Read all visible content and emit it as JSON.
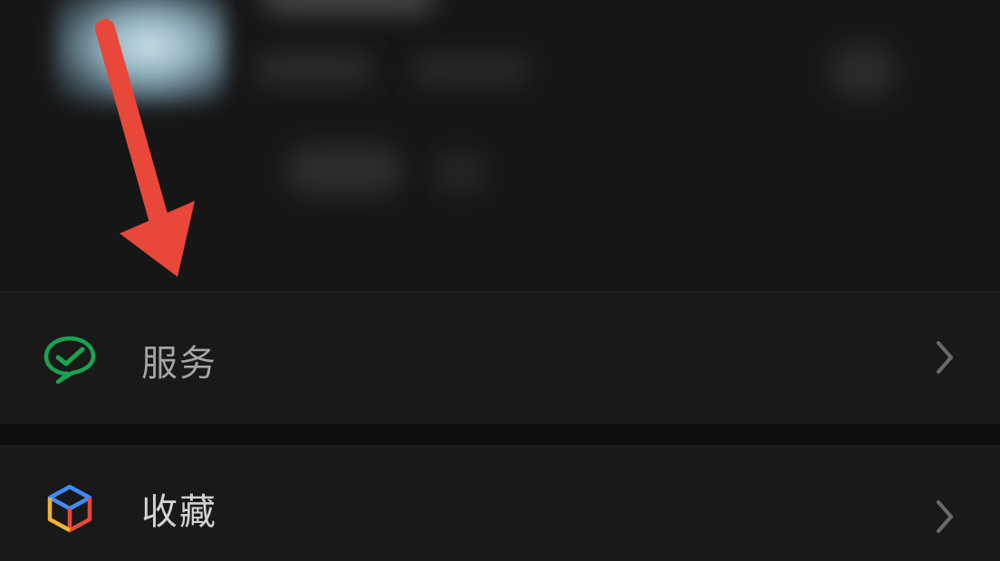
{
  "menu": {
    "items": [
      {
        "id": "services",
        "label": "服务",
        "icon": "wechat-pay-icon",
        "icon_color": "#19a452"
      },
      {
        "id": "favorites",
        "label": "收藏",
        "icon": "favorites-cube-icon",
        "icon_colors": [
          "#3f8cff",
          "#e8473f",
          "#f2b233"
        ]
      }
    ]
  },
  "annotation": {
    "arrow_color": "#e8473a"
  },
  "colors": {
    "background": "#111111",
    "row_background": "#191919",
    "chevron": "#6a6a6a"
  }
}
